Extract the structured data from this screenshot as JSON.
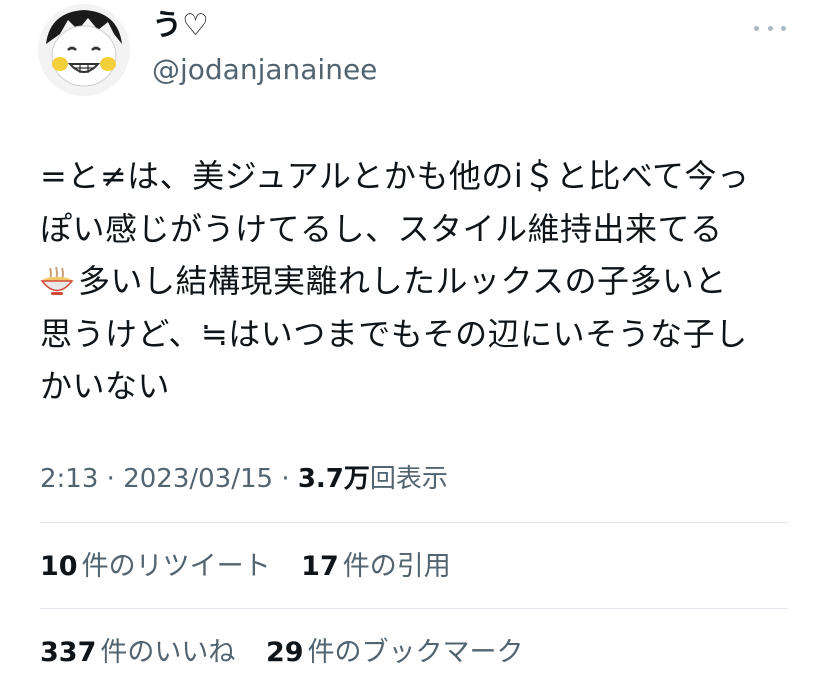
{
  "user": {
    "display_name": "う♡",
    "handle": "@jodanjanainee"
  },
  "tweet": {
    "lines": [
      "=と≠は、美ジュアルとかも他のi＄と比べて今っ",
      "ぽい感じがうけてるし、スタイル維持出来てる",
      "多いし結構現実離れしたルックスの子多いと",
      "思うけど、≒はいつまでもその辺にいそうな子し",
      "かいない"
    ],
    "emoji": "noodle-bowl-icon"
  },
  "meta": {
    "time": "2:13",
    "sep1": "·",
    "date": "2023/03/15",
    "sep2": "·",
    "views": "3.7万",
    "views_label": "回表示"
  },
  "stats": {
    "retweets_count": "10",
    "retweets_label": "件のリツイート",
    "quotes_count": "17",
    "quotes_label": "件の引用",
    "likes_count": "337",
    "likes_label": "件のいいね",
    "bookmarks_count": "29",
    "bookmarks_label": "件のブックマーク"
  },
  "colors": {
    "text_primary": "#0f1419",
    "text_secondary": "#536471",
    "divider": "#e1e8ed"
  }
}
